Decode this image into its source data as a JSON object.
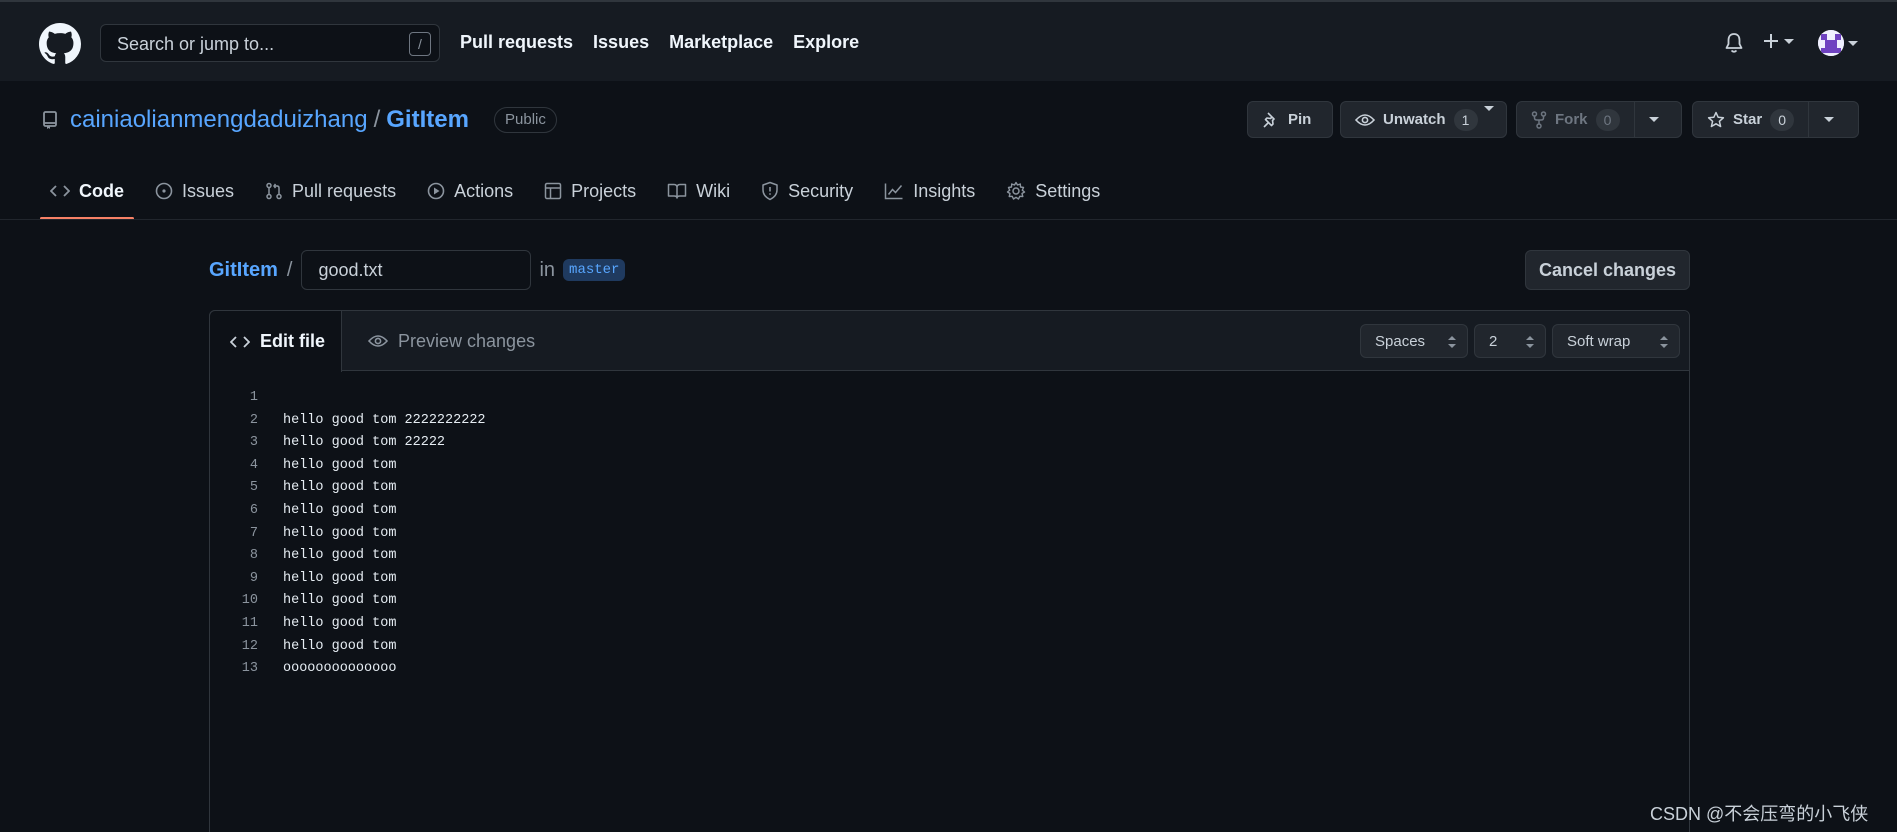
{
  "header": {
    "search_placeholder": "Search or jump to...",
    "search_shortcut": "/",
    "nav": [
      "Pull requests",
      "Issues",
      "Marketplace",
      "Explore"
    ]
  },
  "repo": {
    "owner": "cainiaolianmengdaduizhang",
    "separator": "/",
    "name": "GitItem",
    "visibility": "Public",
    "pin_label": "Pin",
    "unwatch_label": "Unwatch",
    "watch_count": "1",
    "fork_label": "Fork",
    "fork_count": "0",
    "star_label": "Star",
    "star_count": "0"
  },
  "tabs": [
    {
      "label": "Code",
      "icon": "code-icon",
      "active": true
    },
    {
      "label": "Issues",
      "icon": "issue-opened-icon"
    },
    {
      "label": "Pull requests",
      "icon": "git-pull-request-icon"
    },
    {
      "label": "Actions",
      "icon": "play-icon"
    },
    {
      "label": "Projects",
      "icon": "table-icon"
    },
    {
      "label": "Wiki",
      "icon": "book-icon"
    },
    {
      "label": "Security",
      "icon": "shield-icon"
    },
    {
      "label": "Insights",
      "icon": "graph-icon"
    },
    {
      "label": "Settings",
      "icon": "gear-icon"
    }
  ],
  "editor": {
    "breadcrumb_repo": "GitItem",
    "breadcrumb_sep": "/",
    "filename": "good.txt",
    "in_label": "in",
    "branch": "master",
    "cancel_label": "Cancel changes",
    "edit_tab": "Edit file",
    "preview_tab": "Preview changes",
    "indent_mode": "Spaces",
    "indent_size": "2",
    "wrap_mode": "Soft wrap",
    "lines": [
      "",
      "hello good tom 2222222222",
      "hello good tom 22222",
      "hello good tom",
      "hello good tom",
      "hello good tom",
      "hello good tom",
      "hello good tom",
      "hello good tom",
      "hello good tom",
      "hello good tom",
      "hello good tom",
      "oooooooooooooo"
    ]
  },
  "watermark": "CSDN @不会压弯的小飞侠",
  "colors": {
    "accent": "#58a6ff",
    "active_tab_underline": "#f78166",
    "background": "#0d1117",
    "header": "#161b22"
  }
}
